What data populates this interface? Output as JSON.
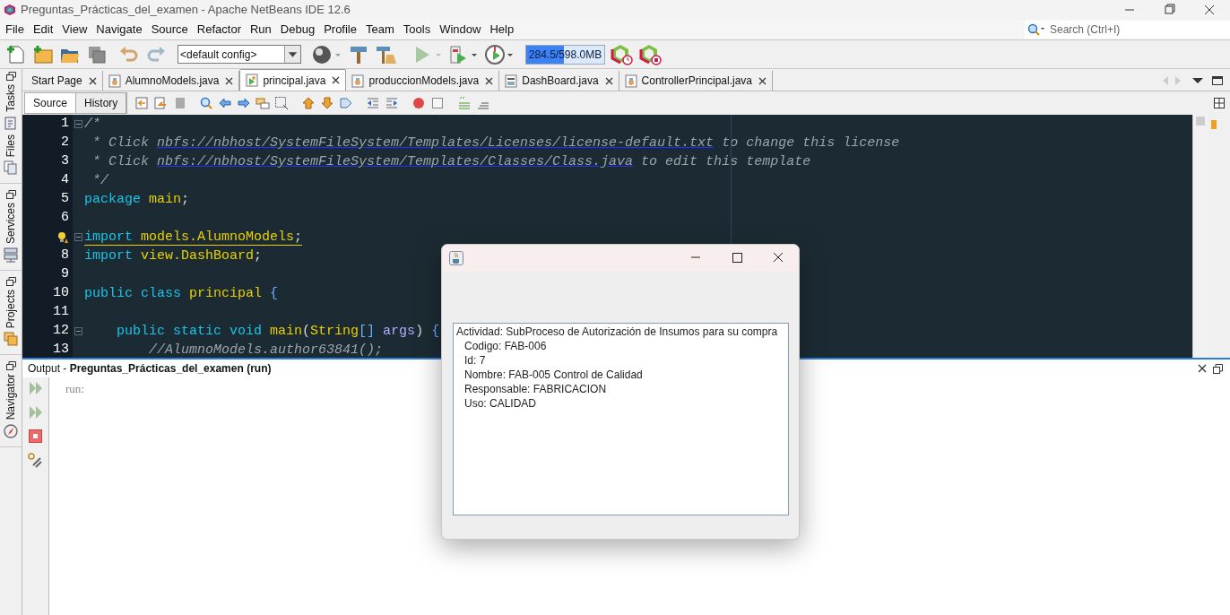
{
  "window": {
    "title": "Preguntas_Prácticas_del_examen - Apache NetBeans IDE 12.6"
  },
  "menu": [
    "File",
    "Edit",
    "View",
    "Navigate",
    "Source",
    "Refactor",
    "Run",
    "Debug",
    "Profile",
    "Team",
    "Tools",
    "Window",
    "Help"
  ],
  "search": {
    "placeholder": "Search (Ctrl+I)"
  },
  "toolbar": {
    "config": "<default config>",
    "memory": {
      "reading": "284.5/598.0MB",
      "level": 0.48
    }
  },
  "side_panels": [
    "Tasks",
    "Files",
    "Services",
    "Projects",
    "Navigator"
  ],
  "tabs": [
    {
      "label": "Start Page",
      "selected": false,
      "kind": "page"
    },
    {
      "label": "AlumnoModels.java",
      "selected": false,
      "kind": "java"
    },
    {
      "label": "principal.java",
      "selected": true,
      "kind": "main"
    },
    {
      "label": "produccionModels.java",
      "selected": false,
      "kind": "java"
    },
    {
      "label": "DashBoard.java",
      "selected": false,
      "kind": "form"
    },
    {
      "label": "ControllerPrincipal.java",
      "selected": false,
      "kind": "java"
    }
  ],
  "editor_views": [
    {
      "label": "Source",
      "selected": true
    },
    {
      "label": "History",
      "selected": false
    }
  ],
  "code": [
    {
      "number": "1",
      "fold": true,
      "tokens": [
        {
          "kind": "comment",
          "text": "/*"
        }
      ]
    },
    {
      "number": "2",
      "tokens": [
        {
          "kind": "comment",
          "text": " * Click "
        },
        {
          "kind": "link",
          "text": "nbfs://nbhost/SystemFileSystem/Templates/Licenses/license-default.txt"
        },
        {
          "kind": "comment",
          "text": " to change this license"
        }
      ]
    },
    {
      "number": "3",
      "tokens": [
        {
          "kind": "comment",
          "text": " * Click "
        },
        {
          "kind": "link",
          "text": "nbfs://nbhost/SystemFileSystem/Templates/Classes/Class.java"
        },
        {
          "kind": "comment",
          "text": " to edit this template"
        }
      ]
    },
    {
      "number": "4",
      "tokens": [
        {
          "kind": "comment",
          "text": " */"
        }
      ]
    },
    {
      "number": "5",
      "tokens": [
        {
          "kind": "keyword",
          "text": "package"
        },
        {
          "kind": "ident",
          "text": " main"
        },
        {
          "kind": "punct",
          "text": ";"
        }
      ]
    },
    {
      "number": "6"
    },
    {
      "warning": true,
      "fold": true,
      "tokens": [
        {
          "kind": "keyword",
          "text": "import"
        },
        {
          "kind": "ident",
          "text": " models.AlumnoModels"
        },
        {
          "kind": "punct",
          "text": ";"
        }
      ]
    },
    {
      "number": "8",
      "tokens": [
        {
          "kind": "keyword",
          "text": "import"
        },
        {
          "kind": "ident",
          "text": " view.DashBoard"
        },
        {
          "kind": "punct",
          "text": ";"
        }
      ]
    },
    {
      "number": "9"
    },
    {
      "number": "10",
      "tokens": [
        {
          "kind": "keyword",
          "text": "public class"
        },
        {
          "kind": "ident",
          "text": " principal "
        },
        {
          "kind": "brace",
          "text": "{"
        }
      ]
    },
    {
      "number": "11"
    },
    {
      "number": "12",
      "fold": true,
      "tokens": [
        {
          "kind": "keyword",
          "text": "    public static void"
        },
        {
          "kind": "ident",
          "text": " main"
        },
        {
          "kind": "punct",
          "text": "("
        },
        {
          "kind": "ident",
          "text": "String"
        },
        {
          "kind": "brace",
          "text": "[] "
        },
        {
          "kind": "param",
          "text": "args"
        },
        {
          "kind": "punct",
          "text": ") "
        },
        {
          "kind": "brace",
          "text": "{"
        }
      ]
    },
    {
      "number": "13",
      "tokens": [
        {
          "kind": "comment",
          "text": "        //AlumnoModels.author63841();"
        }
      ]
    }
  ],
  "output": {
    "title": "Output - **Preguntas_Prácticas_del_examen (run)**",
    "lines": [
      "run:"
    ]
  },
  "dialog": {
    "lines": [
      {
        "text": "Actividad: SubProceso de Autorización de Insumos para su compra",
        "indented": false
      },
      {
        "text": "Codigo: FAB-006",
        "indented": true
      },
      {
        "text": "Id: 7",
        "indented": true
      },
      {
        "text": "Nombre: FAB-005 Control de Calidad",
        "indented": true
      },
      {
        "text": "Responsable: FABRICACION",
        "indented": true
      },
      {
        "text": "Uso: CALIDAD",
        "indented": true
      }
    ]
  }
}
